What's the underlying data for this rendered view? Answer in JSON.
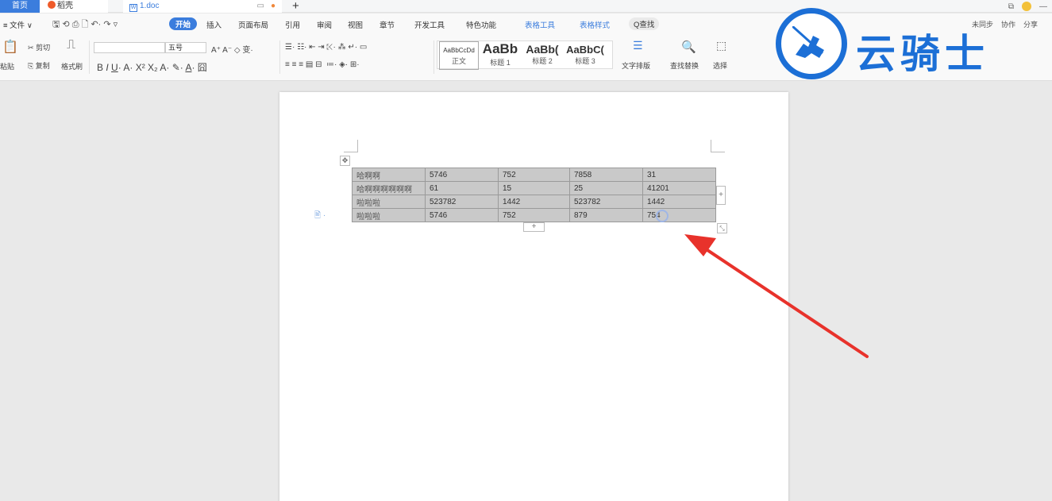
{
  "tabs": {
    "home": "首页",
    "daoke": "稻壳",
    "doc": "1.doc",
    "new_tab": "+"
  },
  "menu": {
    "file": "≡ 文件 ∨",
    "items": [
      "开始",
      "插入",
      "页面布局",
      "引用",
      "审阅",
      "视图",
      "章节",
      "开发工具",
      "特色功能",
      "表格工具",
      "表格样式"
    ],
    "search": "Q查找",
    "right": [
      "未同步",
      "协作",
      "分享"
    ]
  },
  "ribbon": {
    "paste": "粘贴",
    "cut": "剪切",
    "copy": "复制",
    "format_painter": "格式刷",
    "font_size": "五号",
    "styles": [
      {
        "sample": "AaBbCcDd",
        "caption": "正文"
      },
      {
        "sample": "AaBb",
        "caption": "标题 1"
      },
      {
        "sample": "AaBb(",
        "caption": "标题 2"
      },
      {
        "sample": "AaBbC(",
        "caption": "标题 3"
      }
    ],
    "text_layout": "文字排版",
    "find_replace": "查找替换",
    "select": "选择"
  },
  "logo": {
    "text": "云骑士"
  },
  "table": {
    "rows": [
      [
        "哈啊啊",
        "5746",
        "752",
        "7858",
        "31"
      ],
      [
        "哈啊啊啊啊啊啊",
        "61",
        "15",
        "25",
        "41201"
      ],
      [
        "啦啦啦",
        "523782",
        "1442",
        "523782",
        "1442"
      ],
      [
        "啦啦啦",
        "5746",
        "752",
        "879",
        "754"
      ]
    ]
  },
  "colors": {
    "accent": "#3b7ddd",
    "logo_blue": "#1c6fd6",
    "arrow_red": "#e8322b",
    "table_fill": "#c9c9c9"
  }
}
